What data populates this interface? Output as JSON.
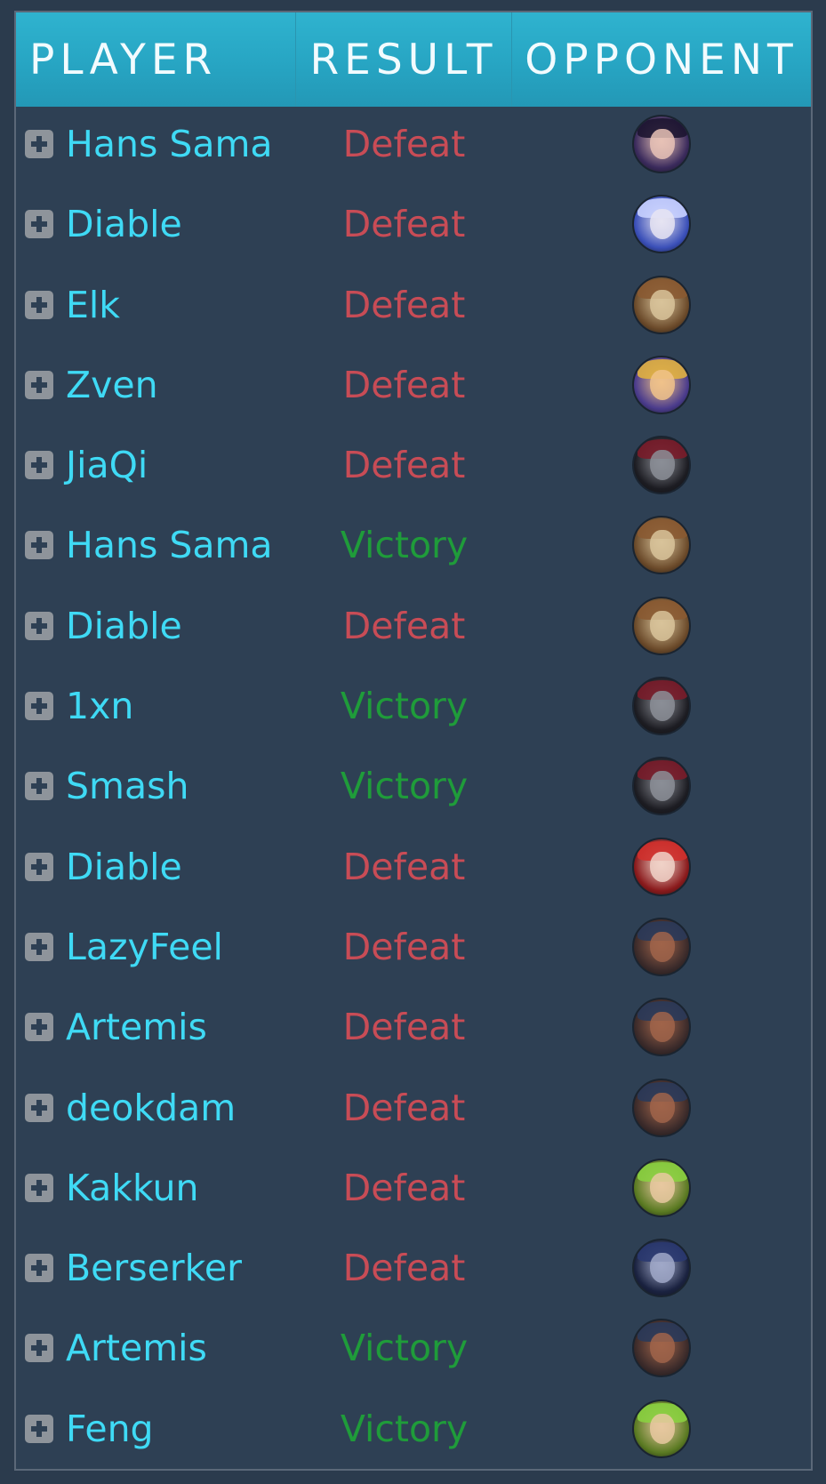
{
  "header": {
    "player": "PLAYER",
    "result": "RESULT",
    "opponent": "OPPONENT"
  },
  "rows": [
    {
      "player": "Hans Sama",
      "result": "Defeat",
      "outcome": "defeat",
      "opponent_icon": "dark-haired-champion-portrait",
      "colors": [
        "#3a2a5c",
        "#e8c2b6",
        "#1c1430"
      ]
    },
    {
      "player": "Diable",
      "result": "Defeat",
      "outcome": "defeat",
      "opponent_icon": "white-haired-champion-portrait",
      "colors": [
        "#3a4fb8",
        "#e6e4f2",
        "#c9d2ff"
      ]
    },
    {
      "player": "Elk",
      "result": "Defeat",
      "outcome": "defeat",
      "opponent_icon": "goggled-yordle-portrait",
      "colors": [
        "#6b4a2a",
        "#d8c39a",
        "#8a5a32"
      ]
    },
    {
      "player": "Zven",
      "result": "Defeat",
      "outcome": "defeat",
      "opponent_icon": "blonde-champion-portrait",
      "colors": [
        "#4a3b8c",
        "#f0c28a",
        "#e0b040"
      ]
    },
    {
      "player": "JiaQi",
      "result": "Defeat",
      "outcome": "defeat",
      "opponent_icon": "masked-champion-portrait",
      "colors": [
        "#1c1c22",
        "#8b8e96",
        "#7a1c2a"
      ]
    },
    {
      "player": "Hans Sama",
      "result": "Victory",
      "outcome": "victory",
      "opponent_icon": "goggled-yordle-portrait",
      "colors": [
        "#6b4a2a",
        "#d8c39a",
        "#8a5a32"
      ]
    },
    {
      "player": "Diable",
      "result": "Defeat",
      "outcome": "defeat",
      "opponent_icon": "goggled-yordle-portrait",
      "colors": [
        "#6b4a2a",
        "#d8c39a",
        "#8a5a32"
      ]
    },
    {
      "player": "1xn",
      "result": "Victory",
      "outcome": "victory",
      "opponent_icon": "masked-champion-portrait",
      "colors": [
        "#1c1c22",
        "#8b8e96",
        "#7a1c2a"
      ]
    },
    {
      "player": "Smash",
      "result": "Victory",
      "outcome": "victory",
      "opponent_icon": "masked-champion-portrait",
      "colors": [
        "#1c1c22",
        "#8b8e96",
        "#7a1c2a"
      ]
    },
    {
      "player": "Diable",
      "result": "Defeat",
      "outcome": "defeat",
      "opponent_icon": "red-haired-champion-portrait",
      "colors": [
        "#8a1a1c",
        "#f0d2c8",
        "#d0302c"
      ]
    },
    {
      "player": "LazyFeel",
      "result": "Defeat",
      "outcome": "defeat",
      "opponent_icon": "bald-warrior-portrait",
      "colors": [
        "#3a2a2a",
        "#a0644a",
        "#2a3a5a"
      ]
    },
    {
      "player": "Artemis",
      "result": "Defeat",
      "outcome": "defeat",
      "opponent_icon": "bald-warrior-portrait",
      "colors": [
        "#3a2a2a",
        "#a0644a",
        "#2a3a5a"
      ]
    },
    {
      "player": "deokdam",
      "result": "Defeat",
      "outcome": "defeat",
      "opponent_icon": "bald-warrior-portrait",
      "colors": [
        "#3a2a2a",
        "#a0644a",
        "#2a3a5a"
      ]
    },
    {
      "player": "Kakkun",
      "result": "Defeat",
      "outcome": "defeat",
      "opponent_icon": "green-haired-champion-portrait",
      "colors": [
        "#5a7a22",
        "#e8c8a0",
        "#8ad040"
      ]
    },
    {
      "player": "Berserker",
      "result": "Defeat",
      "outcome": "defeat",
      "opponent_icon": "dark-hooded-champion-portrait",
      "colors": [
        "#1a2240",
        "#a0a8c8",
        "#2a3870"
      ]
    },
    {
      "player": "Artemis",
      "result": "Victory",
      "outcome": "victory",
      "opponent_icon": "bald-warrior-portrait",
      "colors": [
        "#3a2a2a",
        "#a0644a",
        "#2a3a5a"
      ]
    },
    {
      "player": "Feng",
      "result": "Victory",
      "outcome": "victory",
      "opponent_icon": "green-haired-champion-portrait",
      "colors": [
        "#5a7a22",
        "#e8c8a0",
        "#8ad040"
      ]
    }
  ]
}
